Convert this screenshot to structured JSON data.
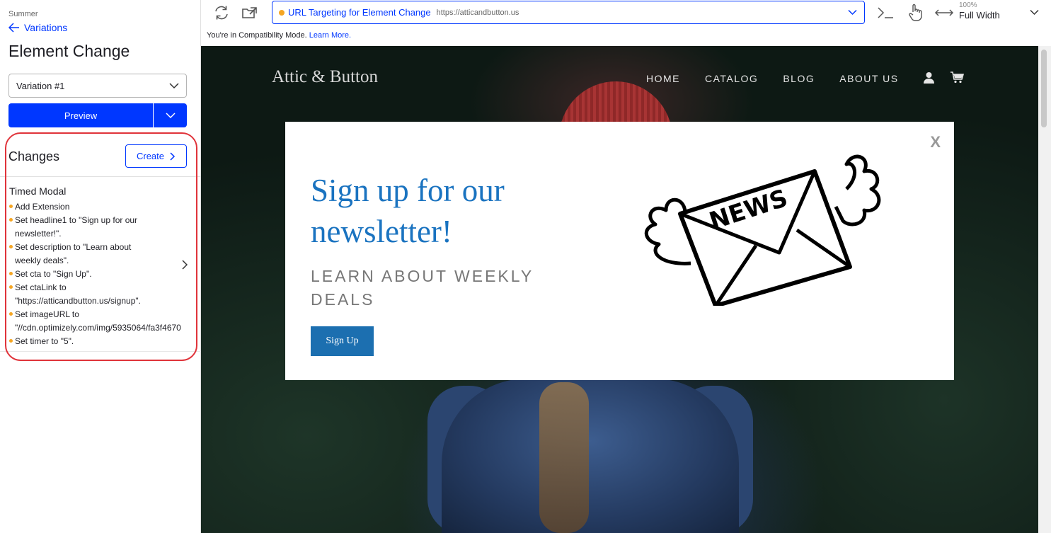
{
  "sidebar": {
    "project_name": "Summer",
    "back_label": "Variations",
    "page_title": "Element Change",
    "variation_selected": "Variation #1",
    "preview_label": "Preview",
    "changes_title": "Changes",
    "create_label": "Create",
    "change": {
      "title": "Timed Modal",
      "items": [
        "Add Extension",
        "Set headline1 to \"Sign up for our\nnewsletter!\".",
        "Set description to \"Learn about\nweekly deals\".",
        "Set cta to \"Sign Up\".",
        "Set ctaLink to\n\"https://atticandbutton.us/signup\".",
        "Set imageURL to\n\"//cdn.optimizely.com/img/5935064/fa3f4670",
        "Set timer to \"5\"."
      ]
    }
  },
  "toolbar": {
    "url_name": "URL Targeting for Element Change",
    "url_address": "https://atticandbutton.us",
    "zoom_level": "100%",
    "zoom_mode": "Full Width"
  },
  "compat": {
    "text": "You're in Compatibility Mode.",
    "link": "Learn More."
  },
  "site": {
    "logo": "Attic & Button",
    "nav": [
      "HOME",
      "CATALOG",
      "BLOG",
      "ABOUT US"
    ]
  },
  "modal": {
    "close": "X",
    "headline": "Sign up for our newsletter!",
    "description": "LEARN ABOUT WEEKLY DEALS",
    "cta": "Sign Up",
    "image_text": "NEWS"
  },
  "colors": {
    "accent": "#0037ff",
    "bullet": "#f5a623",
    "highlight": "#e0333a",
    "modal_headline": "#1a73c0",
    "modal_cta": "#1c6fb0"
  }
}
